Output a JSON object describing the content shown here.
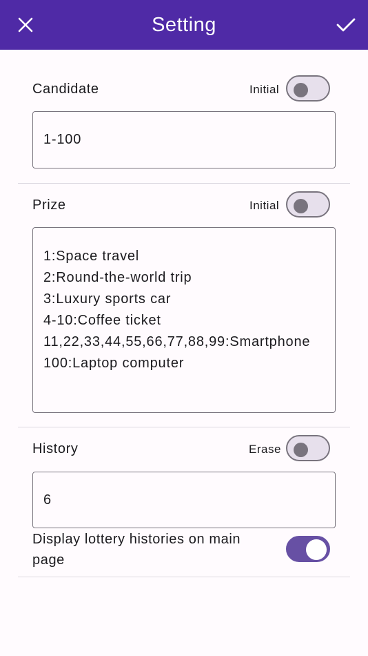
{
  "appbar": {
    "title": "Setting",
    "close_icon": "close-icon",
    "save_icon": "check-icon",
    "background": "#4f2aa6"
  },
  "candidate": {
    "label": "Candidate",
    "toggle_label": "Initial",
    "toggle_on": false,
    "value": "1-100"
  },
  "prize": {
    "label": "Prize",
    "toggle_label": "Initial",
    "toggle_on": false,
    "value": "1:Space travel\n2:Round-the-world trip\n3:Luxury sports car\n4-10:Coffee ticket\n11,22,33,44,55,66,77,88,99:Smartphone\n100:Laptop computer"
  },
  "history": {
    "label": "History",
    "toggle_label": "Erase",
    "toggle_on": false,
    "value": "6",
    "display_label": "Display lottery histories on main page",
    "display_on": true
  },
  "colors": {
    "accent": "#6750a4",
    "outline": "#79747e",
    "divider": "#dcd8e0"
  }
}
